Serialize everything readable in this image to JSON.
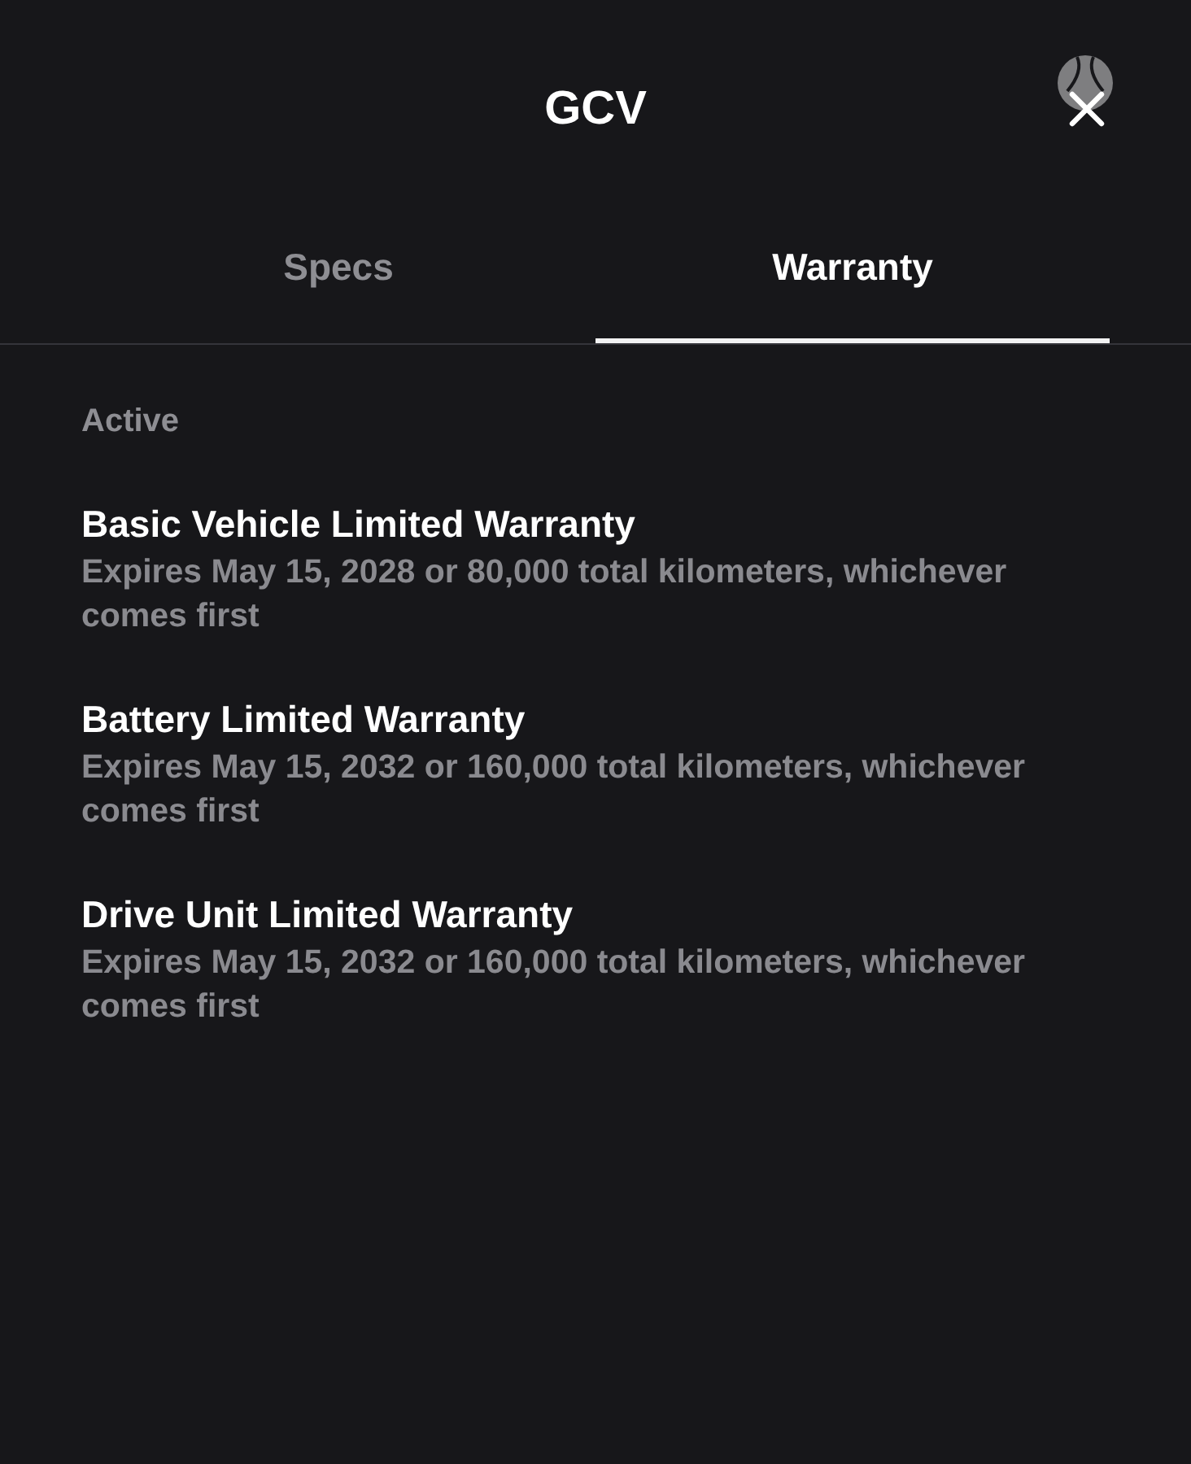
{
  "header": {
    "title": "GCV"
  },
  "tabs": [
    {
      "label": "Specs",
      "selected": false
    },
    {
      "label": "Warranty",
      "selected": true
    }
  ],
  "section": {
    "heading": "Active",
    "warranties": [
      {
        "title": "Basic Vehicle Limited Warranty",
        "terms": "Expires May 15, 2028 or 80,000 total kilometers, whichever comes first"
      },
      {
        "title": "Battery Limited Warranty",
        "terms": "Expires May 15, 2032 or 160,000 total kilometers, whichever comes first"
      },
      {
        "title": "Drive Unit Limited Warranty",
        "terms": "Expires May 15, 2032 or 160,000 total kilometers, whichever comes first"
      }
    ]
  }
}
